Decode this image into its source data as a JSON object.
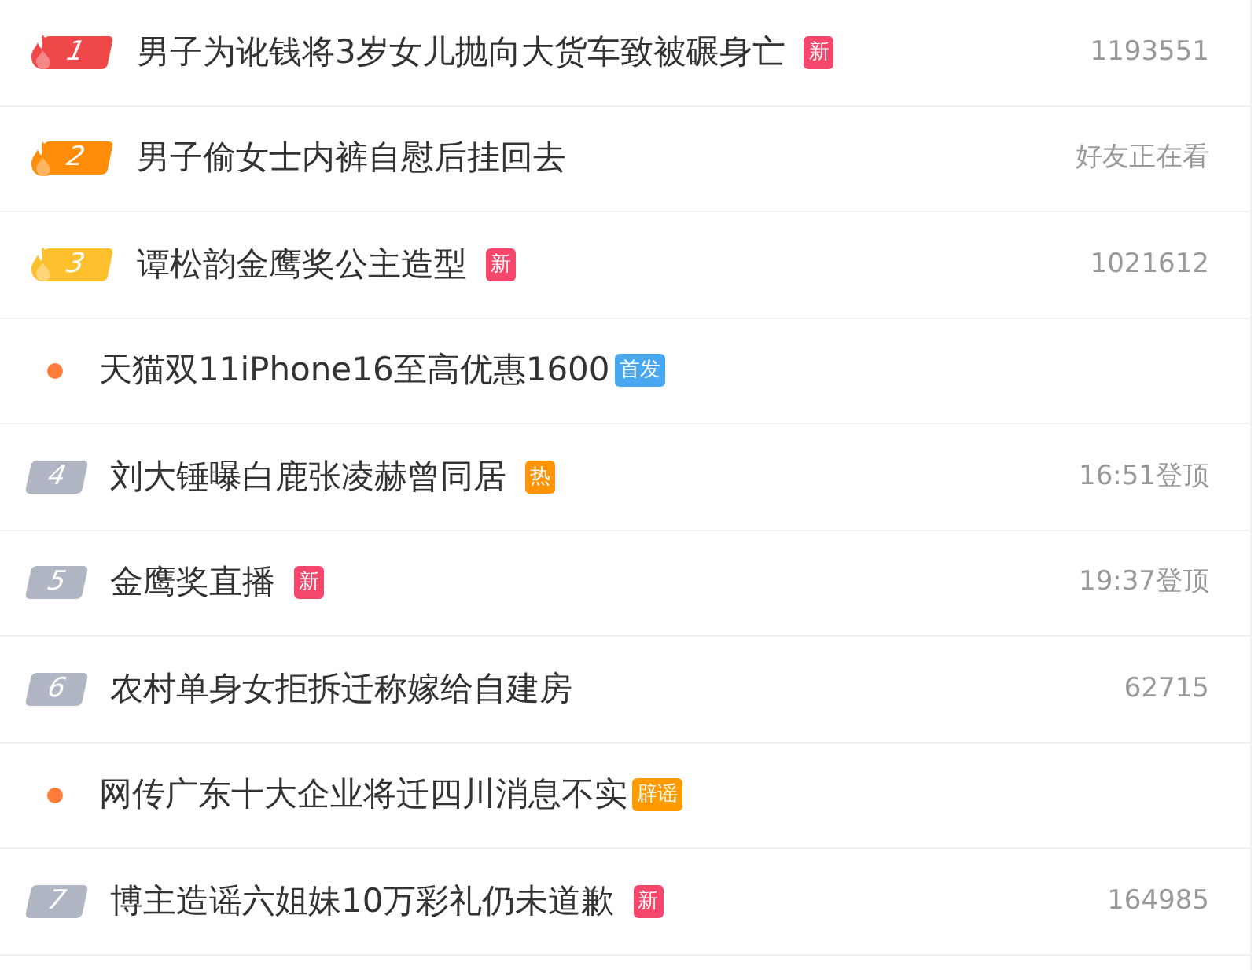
{
  "items": [
    {
      "kind": "hot",
      "rank": "1",
      "color": "#f04848",
      "title": "男子为讹钱将3岁女儿抛向大货车致被碾身亡",
      "tag": {
        "text": "新",
        "color": "#f4476b"
      },
      "meta": "1193551"
    },
    {
      "kind": "hot",
      "rank": "2",
      "color": "#ff8d0a",
      "title": "男子偷女士内裤自慰后挂回去",
      "meta": "好友正在看"
    },
    {
      "kind": "hot",
      "rank": "3",
      "color": "#ffc02e",
      "title": "谭松韵金鹰奖公主造型",
      "tag": {
        "text": "新",
        "color": "#f4476b"
      },
      "meta": "1021612"
    },
    {
      "kind": "ad",
      "title": "天猫双11iPhone16至高优惠1600",
      "tag": {
        "text": "首发",
        "color": "#4aa8f0"
      }
    },
    {
      "kind": "plain",
      "rank": "4",
      "title": "刘大锤曝白鹿张凌赫曾同居",
      "tag": {
        "text": "热",
        "color": "#ff9406"
      },
      "meta": "16:51登顶"
    },
    {
      "kind": "plain",
      "rank": "5",
      "title": "金鹰奖直播",
      "tag": {
        "text": "新",
        "color": "#f4476b"
      },
      "meta": "19:37登顶"
    },
    {
      "kind": "plain",
      "rank": "6",
      "title": "农村单身女拒拆迁称嫁给自建房",
      "meta": "62715"
    },
    {
      "kind": "ad",
      "title": "网传广东十大企业将迁四川消息不实",
      "tag": {
        "text": "辟谣",
        "color": "#ff9a00"
      }
    },
    {
      "kind": "plain",
      "rank": "7",
      "title": "博主造谣六姐妹10万彩礼仍未道歉",
      "tag": {
        "text": "新",
        "color": "#f4476b"
      },
      "meta": "164985"
    }
  ]
}
